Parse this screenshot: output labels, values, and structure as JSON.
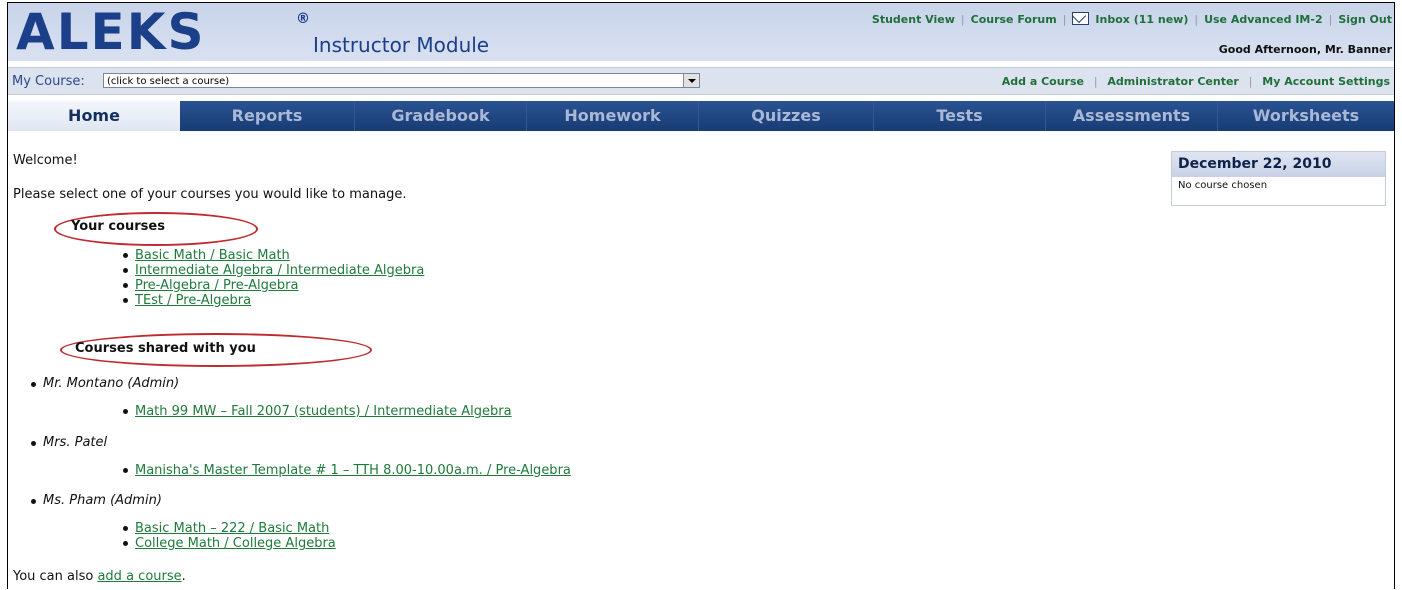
{
  "header": {
    "logo": "ALEKS",
    "registered": "®",
    "module": "Instructor Module",
    "links": [
      "Student View",
      "Course Forum",
      "Inbox (11 new)",
      "Use Advanced IM-2",
      "Sign Out"
    ],
    "greeting": "Good Afternoon, Mr. Banner"
  },
  "coursebar": {
    "label": "My Course:",
    "select_value": "(click to select a course)",
    "links": [
      "Add a Course",
      "Administrator Center",
      "My Account Settings"
    ]
  },
  "tabs": [
    "Home",
    "Reports",
    "Gradebook",
    "Homework",
    "Quizzes",
    "Tests",
    "Assessments",
    "Worksheets"
  ],
  "main": {
    "welcome": "Welcome!",
    "prompt": "Please select one of your courses you would like to manage.",
    "your_courses_title": "Your courses",
    "your_courses": [
      "Basic Math / Basic Math",
      "Intermediate Algebra / Intermediate Algebra",
      "Pre-Algebra / Pre-Algebra",
      "TEst / Pre-Algebra"
    ],
    "shared_title": "Courses shared with you",
    "shared": [
      {
        "owner": "Mr. Montano (Admin)",
        "courses": [
          "Math 99 MW – Fall 2007 (students) / Intermediate Algebra"
        ]
      },
      {
        "owner": "Mrs. Patel",
        "courses": [
          "Manisha's Master Template # 1 – TTH 8.00-10.00a.m. / Pre-Algebra"
        ]
      },
      {
        "owner": "Ms. Pham (Admin)",
        "courses": [
          "Basic Math – 222 / Basic Math",
          "College Math / College Algebra"
        ]
      }
    ],
    "also_prefix": "You can also ",
    "also_link": "add a course",
    "also_suffix": "."
  },
  "datepanel": {
    "date": "December 22, 2010",
    "status": "No course chosen"
  },
  "colors": {
    "brand_blue": "#1c3f8a",
    "link_green": "#1f7a3b",
    "tab_bar": "#173c74",
    "annotation_red": "#c0292e"
  }
}
